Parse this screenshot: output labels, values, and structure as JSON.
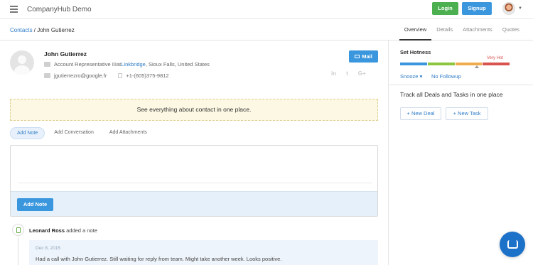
{
  "app": {
    "title": "CompanyHub Demo",
    "login_label": "Login",
    "signup_label": "Signup"
  },
  "breadcrumb": {
    "parent": "Contacts",
    "separator": " / ",
    "current": "John Gutierrez"
  },
  "tabs": [
    {
      "label": "Overview",
      "active": true
    },
    {
      "label": "Details",
      "active": false
    },
    {
      "label": "Attachments",
      "active": false
    },
    {
      "label": "Quotes",
      "active": false
    }
  ],
  "contact": {
    "name": "John Gutierrez",
    "title": "Account Representative III",
    "at": " at ",
    "company": "Linkbridge",
    "location": ", Sioux Falls, United States",
    "email": "jgutierrezro@google.fr",
    "phone": "+1-(605)375-9812",
    "mail_label": "Mail",
    "socials": [
      "in",
      "t",
      "G+"
    ]
  },
  "banner": {
    "text": "See everything about contact in one place."
  },
  "note_tabs": [
    {
      "label": "Add Note",
      "active": true
    },
    {
      "label": "Add Conversation",
      "active": false
    },
    {
      "label": "Add Attachments",
      "active": false
    }
  ],
  "editor": {
    "add_note_label": "Add Note"
  },
  "timeline": {
    "author": "Leonard Ross",
    "action": " added a note",
    "date": "Dec 8, 2015",
    "text": "Had a call with John Gutierrez. Still waiting for reply from team. Might take another week. Looks positive."
  },
  "side": {
    "hotness_title": "Set Hotness",
    "hotness_label": "Very Hot",
    "hotness_colors": [
      "#3a96dd",
      "#8cc63f",
      "#f0ad4e",
      "#d9534f"
    ],
    "snooze_label": "Snooze ▾",
    "followup_label": "No Followup",
    "track_title": "Track all Deals and Tasks in one place",
    "new_deal_label": "+ New Deal",
    "new_task_label": "+ New Task"
  },
  "icons": {
    "menu": "hamburger-icon",
    "chat": "chat-icon"
  }
}
